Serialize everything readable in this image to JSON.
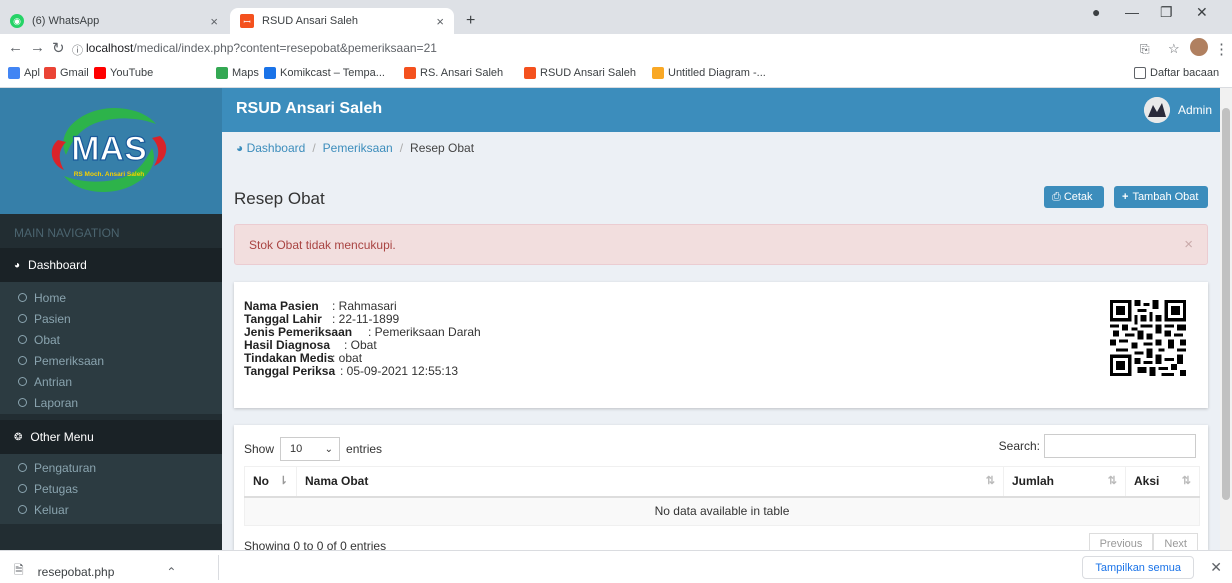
{
  "browser": {
    "tabs": [
      {
        "title": "(6) WhatsApp",
        "icon": "whatsapp-icon"
      },
      {
        "title": "RSUD Ansari Saleh",
        "icon": "site-favicon"
      }
    ],
    "new_tab": "+",
    "close": "×",
    "url_host": "localhost",
    "url_path": "/medical/index.php?content=resepobat&pemeriksaan=21",
    "bookmarks": [
      {
        "label": "Apl",
        "color": "#4285f4"
      },
      {
        "label": "Gmail",
        "color": "#ea4335"
      },
      {
        "label": "YouTube",
        "color": "#ff0000"
      },
      {
        "label": "Maps",
        "color": "#34a853"
      },
      {
        "label": "Komikcast – Tempa...",
        "color": "#1a73e8"
      },
      {
        "label": "RS. Ansari Saleh",
        "color": "#f4511e"
      },
      {
        "label": "RSUD Ansari Saleh",
        "color": "#f4511e"
      },
      {
        "label": "Untitled Diagram -...",
        "color": "#f9a825"
      }
    ],
    "reading_list": "Daftar bacaan"
  },
  "sidebar": {
    "logo_text": "MAS",
    "logo_sub": "RS Moch. Ansari Saleh",
    "main_nav_label": "MAIN NAVIGATION",
    "dashboard_label": "Dashboard",
    "dashboard_items": [
      "Home",
      "Pasien",
      "Obat",
      "Pemeriksaan",
      "Antrian",
      "Laporan"
    ],
    "other_label": "Other Menu",
    "other_items": [
      "Pengaturan",
      "Petugas",
      "Keluar"
    ]
  },
  "topbar": {
    "brand": "RSUD Ansari Saleh",
    "user": "Admin"
  },
  "breadcrumb": {
    "items": [
      "Dashboard",
      "Pemeriksaan",
      "Resep Obat"
    ]
  },
  "page": {
    "title": "Resep Obat",
    "print_label": "Cetak",
    "add_label": "Tambah Obat"
  },
  "alert": {
    "message": "Stok Obat tidak mencukupi.",
    "close": "×"
  },
  "patient": {
    "fields": [
      {
        "label": "Nama Pasien",
        "value": ": Rahmasari"
      },
      {
        "label": "Tanggal Lahir",
        "value": ": 22-11-1899"
      },
      {
        "label": "Jenis Pemeriksaan",
        "value": ": Pemeriksaan Darah"
      },
      {
        "label": "Hasil Diagnosa",
        "value": ": Obat"
      },
      {
        "label": "Tindakan Medis",
        "value": ": obat"
      },
      {
        "label": "Tanggal Periksa",
        "value": ": 05-09-2021 12:55:13"
      }
    ]
  },
  "table": {
    "show_label": "Show",
    "entries_value": "10",
    "entries_label": "entries",
    "search_label": "Search:",
    "columns": [
      "No",
      "Nama Obat",
      "Jumlah",
      "Aksi"
    ],
    "empty_text": "No data available in table",
    "info": "Showing 0 to 0 of 0 entries",
    "prev": "Previous",
    "next": "Next"
  },
  "download": {
    "file": "resepobat.php",
    "show_all": "Tampilkan semua"
  }
}
